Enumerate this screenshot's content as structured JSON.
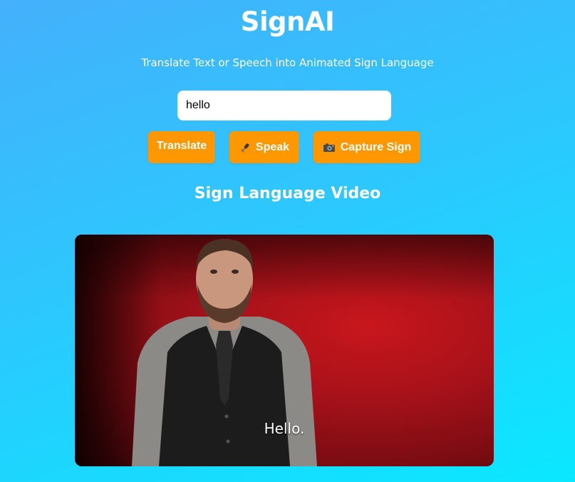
{
  "app": {
    "title": "SignAI",
    "subtitle": "Translate Text or Speech into Animated Sign Language"
  },
  "input": {
    "value": "hello",
    "placeholder": ""
  },
  "buttons": {
    "translate_label": "Translate",
    "speak_label": "Speak",
    "speak_icon": "microphone-icon",
    "capture_label": "Capture Sign",
    "capture_icon": "camera-icon",
    "accent_color": "#ff9800"
  },
  "video_section": {
    "heading": "Sign Language Video",
    "caption": "Hello."
  },
  "colors": {
    "gradient_start": "#44b0fb",
    "gradient_end": "#0ae8ff",
    "text": "#ffffff"
  }
}
